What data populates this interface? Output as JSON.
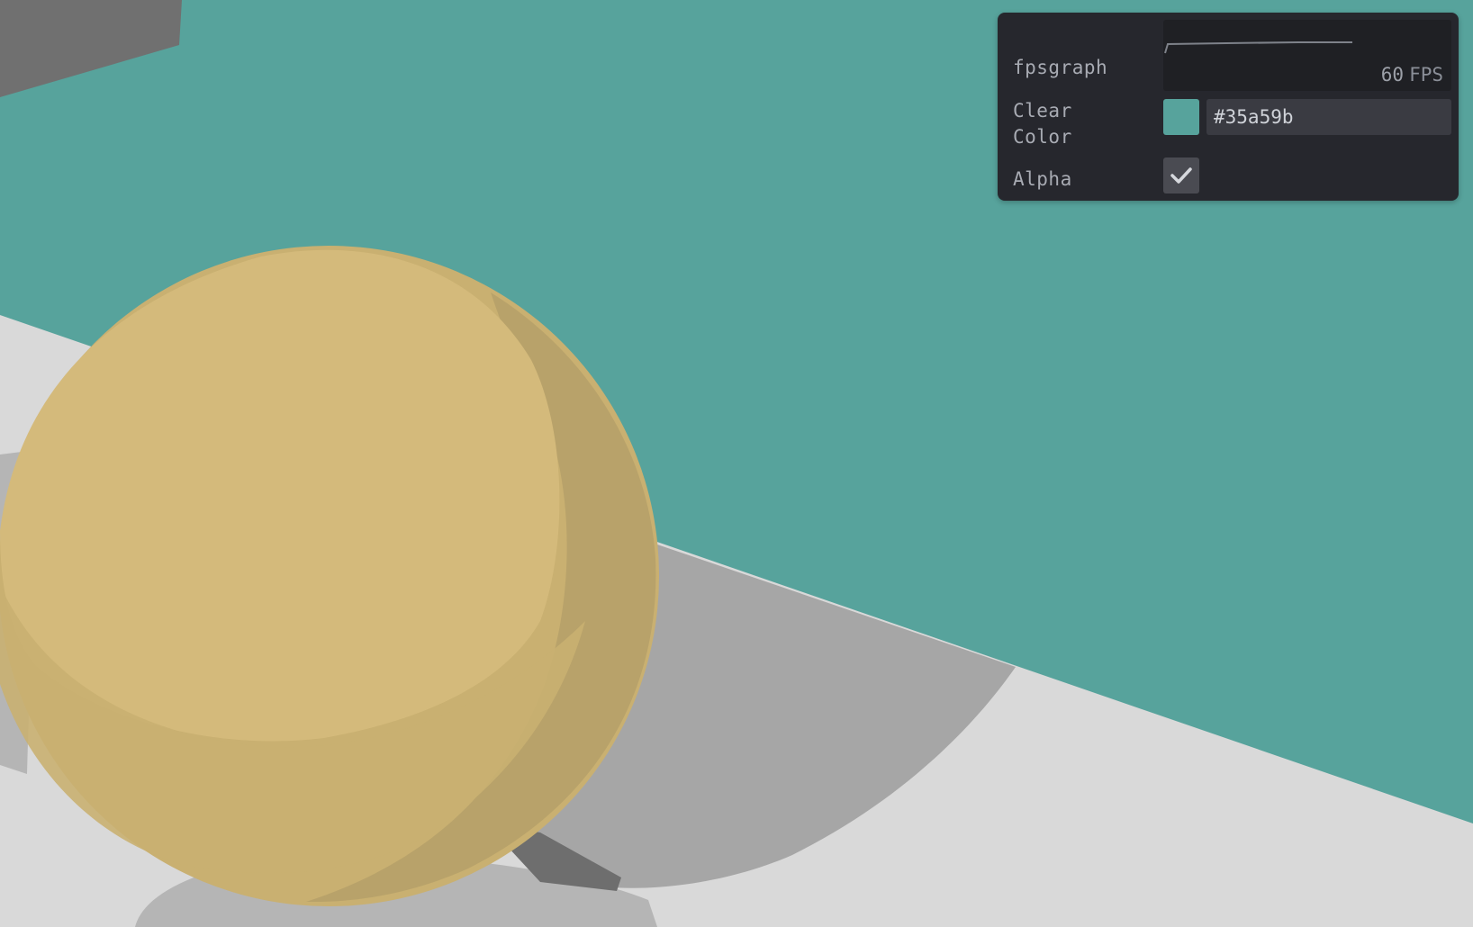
{
  "colors": {
    "background": "#57a39c",
    "floor": "#d9d9d9",
    "shadow": "#a6a6a6",
    "dark_shadow": "#6e6e6e",
    "sphere_light": "#d4ba7b",
    "sphere_mid": "#c9b071",
    "sphere_dark": "#b8a26a",
    "gray_block": "#707070",
    "panel_bg": "#26272d"
  },
  "panel": {
    "fps_row": {
      "label": "fpsgraph",
      "fps_value": "60",
      "fps_unit": "FPS"
    },
    "clear_color_row": {
      "label": "Clear\nColor",
      "swatch_color": "#57a39c",
      "hex_value": "#35a59b"
    },
    "alpha_row": {
      "label": "Alpha",
      "checked": true,
      "check_icon": "checkmark-icon"
    }
  }
}
